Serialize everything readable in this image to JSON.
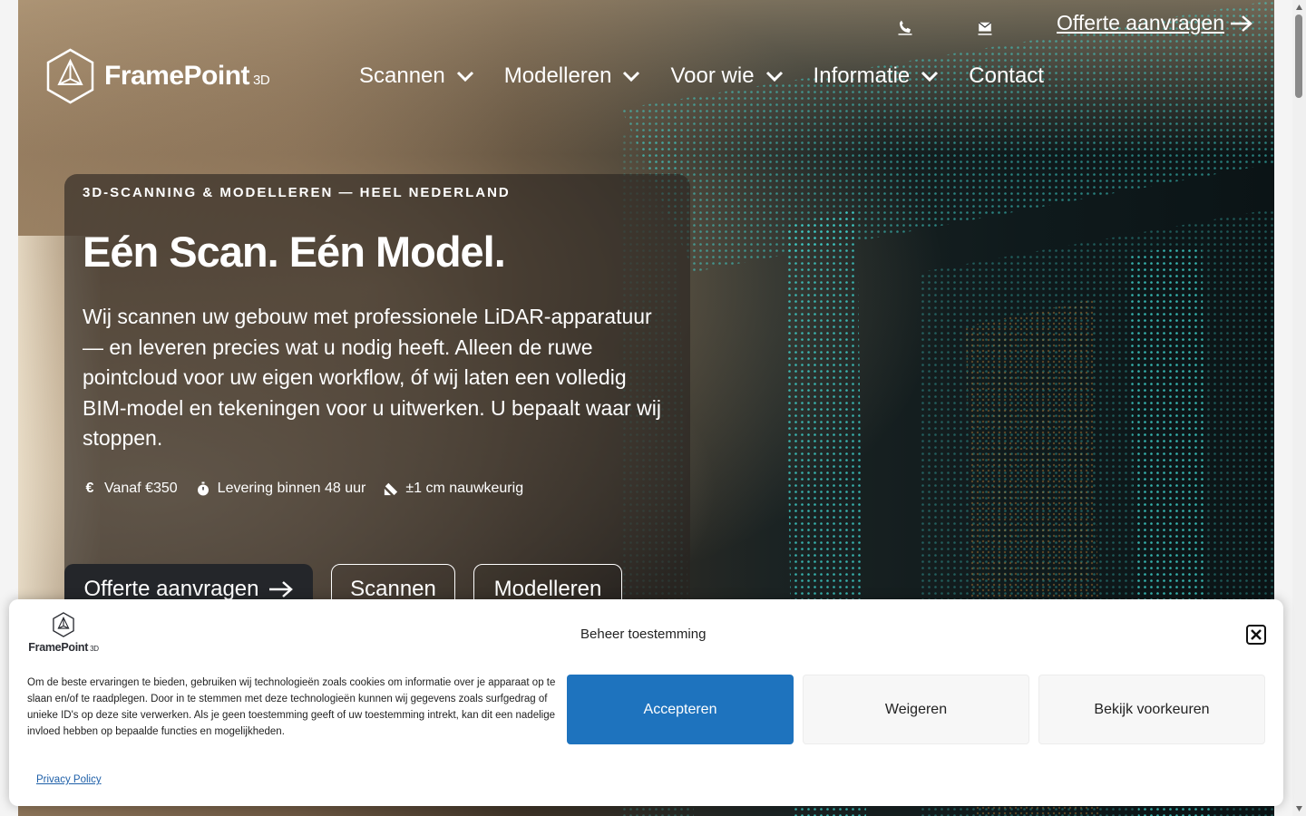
{
  "header": {
    "logo_name": "FramePoint",
    "logo_suffix": "3D",
    "phone_icon": "phone-icon",
    "mail_icon": "mail-icon",
    "cta_label": "Offerte aanvragen"
  },
  "nav": {
    "items": [
      {
        "label": "Scannen",
        "has_dropdown": true
      },
      {
        "label": "Modelleren",
        "has_dropdown": true
      },
      {
        "label": "Voor wie",
        "has_dropdown": true
      },
      {
        "label": "Informatie",
        "has_dropdown": true
      },
      {
        "label": "Contact",
        "has_dropdown": false
      }
    ]
  },
  "hero": {
    "eyebrow": "3D-SCANNING & MODELLEREN — HEEL NEDERLAND",
    "headline": "Eén Scan. Eén Model.",
    "lead": "Wij scannen uw gebouw met professionele LiDAR-apparatuur — en leveren precies wat u nodig heeft. Alleen de ruwe pointcloud voor uw eigen workflow, óf wij laten een volledig BIM-model en tekeningen voor u uitwerken. U bepaalt waar wij stoppen.",
    "facts": [
      {
        "icon": "euro-icon",
        "glyph": "€",
        "text": "Vanaf €350"
      },
      {
        "icon": "stopwatch-icon",
        "glyph": "⏱",
        "text": "Levering binnen 48 uur"
      },
      {
        "icon": "ruler-icon",
        "glyph": "📐",
        "text": "±1 cm nauwkeurig"
      }
    ],
    "btn_primary": "Offerte aanvragen",
    "btn_scan": "Scannen",
    "btn_model": "Modelleren"
  },
  "consent": {
    "logo_name": "FramePoint",
    "logo_suffix": "3D",
    "title": "Beheer toestemming",
    "text": "Om de beste ervaringen te bieden, gebruiken wij technologieën zoals cookies om informatie over je apparaat op te slaan en/of te raadplegen. Door in te stemmen met deze technologieën kunnen wij gegevens zoals surfgedrag of unieke ID's op deze site verwerken. Als je geen toestemming geeft of uw toestemming intrekt, kan dit een nadelige invloed hebben op bepaalde functies en mogelijkheden.",
    "accept": "Accepteren",
    "deny": "Weigeren",
    "prefs": "Bekijk voorkeuren",
    "privacy": "Privacy Policy"
  },
  "colors": {
    "accept_blue": "#1e73be",
    "cloud_teal": "#3fd6d0",
    "cloud_orange": "#e0943a"
  }
}
